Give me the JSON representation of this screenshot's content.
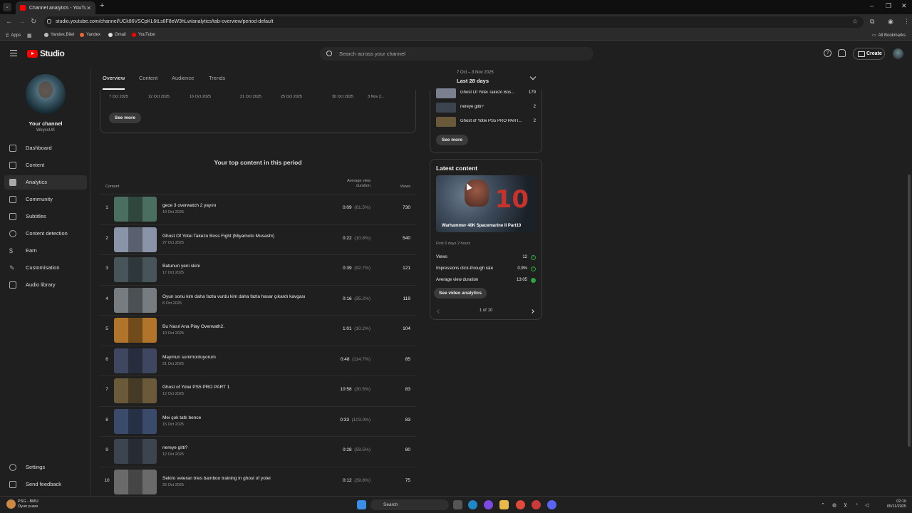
{
  "browser": {
    "tab_title": "Channel analytics - YouTube Studio",
    "url": "studio.youtube.com/channel/UCk86VSCpKL6tLs8F8eW3hLw/analytics/tab-overview/period-default",
    "bookmarks": [
      "Apps",
      "Yandex.Bilet",
      "Yandex",
      "Gmail",
      "YouTube"
    ],
    "all_bookmarks": "All Bookmarks"
  },
  "header": {
    "logo_text": "Studio",
    "search_placeholder": "Search across your channel",
    "create_label": "Create"
  },
  "sidebar": {
    "channel_title": "Your channel",
    "channel_name": "WeyssUK",
    "items": [
      {
        "label": "Dashboard"
      },
      {
        "label": "Content"
      },
      {
        "label": "Analytics"
      },
      {
        "label": "Community"
      },
      {
        "label": "Subtitles"
      },
      {
        "label": "Content detection"
      },
      {
        "label": "Earn"
      },
      {
        "label": "Customisation"
      },
      {
        "label": "Audio library"
      }
    ],
    "settings": "Settings",
    "feedback": "Send feedback"
  },
  "tabs": [
    "Overview",
    "Content",
    "Audience",
    "Trends"
  ],
  "date_range": {
    "dates": "7 Oct – 3 Nov 2025",
    "label": "Last 28 days"
  },
  "chart_axis": [
    "7 Oct 2025",
    "12 Oct 2025",
    "16 Oct 2025",
    "21 Oct 2025",
    "25 Oct 2025",
    "30 Oct 2025",
    "3 Nov 2..."
  ],
  "see_more": "See more",
  "top_content": {
    "title": "Your top content in this period",
    "col_content": "Content",
    "col_avd_1": "Average view",
    "col_avd_2": "duration",
    "col_views": "Views",
    "rows": [
      {
        "idx": "1",
        "title": "gece 3 overwatch 2 yayını",
        "date": "19 Oct 2025",
        "avd": "0:09",
        "pct": "(61.5%)",
        "views": "730",
        "color": "#4a6e60"
      },
      {
        "idx": "2",
        "title": "Ghost Of Yotei Takezo Boss Fight (Miyamoto Musashi)",
        "date": "27 Oct 2025",
        "avd": "0:22",
        "pct": "(10.8%)",
        "views": "540",
        "color": "#8a94a8"
      },
      {
        "idx": "3",
        "title": "Batunun yeni skini",
        "date": "17 Oct 2025",
        "avd": "0:39",
        "pct": "(92.7%)",
        "views": "121",
        "color": "#47555a"
      },
      {
        "idx": "4",
        "title": "Oyun sonu kim daha fazla vurdu kim daha fazla hasar çıkardı kavgası",
        "date": "8 Oct 2025",
        "avd": "0:16",
        "pct": "(35.2%)",
        "views": "119",
        "color": "#777c80"
      },
      {
        "idx": "5",
        "title": "Bu Nasıl Ana Play Overwath2.",
        "date": "10 Oct 2025",
        "avd": "1:01",
        "pct": "(10.2%)",
        "views": "104",
        "color": "#b0742a"
      },
      {
        "idx": "6",
        "title": "Maymun summonluyorum",
        "date": "21 Oct 2025",
        "avd": "0:48",
        "pct": "(114.7%)",
        "views": "85",
        "color": "#3e4660"
      },
      {
        "idx": "7",
        "title": "Ghost of Yotei PS5 PRO PART 1",
        "date": "12 Oct 2025",
        "avd": "10:58",
        "pct": "(30.5%)",
        "views": "83",
        "color": "#6a5a3a"
      },
      {
        "idx": "8",
        "title": "Mei çok tatlı bence",
        "date": "15 Oct 2025",
        "avd": "0:33",
        "pct": "(103.0%)",
        "views": "83",
        "color": "#3a4a6a"
      },
      {
        "idx": "9",
        "title": "nereye gitti?",
        "date": "12 Oct 2025",
        "avd": "0:28",
        "pct": "(59.5%)",
        "views": "80",
        "color": "#3c4450"
      },
      {
        "idx": "10",
        "title": "Sekiro veteran tries bamboo training in ghost of yotei",
        "date": "25 Oct 2025",
        "avd": "0:12",
        "pct": "(39.8%)",
        "views": "75",
        "color": "#6a6a6a"
      }
    ]
  },
  "realtime_list": [
    {
      "title": "Ghost Of Yotei Takezo Bos...",
      "value": "179",
      "color": "#7a8090"
    },
    {
      "title": "nereye gitti?",
      "value": "2",
      "color": "#3c4450"
    },
    {
      "title": "Ghost of Yotei PS5 PRO PART...",
      "value": "2",
      "color": "#6a5a3a"
    }
  ],
  "latest_content": {
    "title": "Latest content",
    "video_title": "Warhammer 40K Spacemarine II Part10",
    "thumb_number": "10",
    "since": "First 6 days 2 hours",
    "stats": [
      {
        "label": "Views",
        "value": "12"
      },
      {
        "label": "Impressions click-through rate",
        "value": "0.9%"
      },
      {
        "label": "Average view duration",
        "value": "13:05"
      }
    ],
    "button": "See video analytics",
    "pager": "1 of 10"
  },
  "taskbar": {
    "weather_1": "PSG - BMU",
    "weather_2": "Oyun puanı",
    "search": "Search",
    "time": "02:10",
    "date": "05/11/2025"
  }
}
